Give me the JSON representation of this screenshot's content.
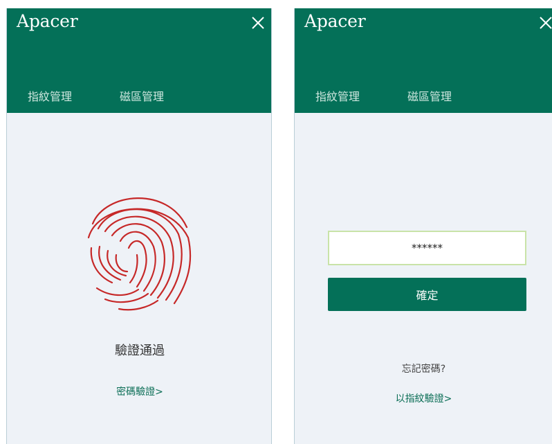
{
  "left_panel": {
    "brand": "Apacer",
    "tabs": [
      "指紋管理",
      "磁區管理"
    ],
    "status_text": "驗證通過",
    "switch_link": "密碼驗證>"
  },
  "right_panel": {
    "brand": "Apacer",
    "tabs": [
      "指紋管理",
      "磁區管理"
    ],
    "password_value": "******",
    "confirm_label": "確定",
    "forgot_link": "忘記密碼?",
    "switch_link": "以指紋驗證>"
  },
  "colors": {
    "header": "#047058",
    "accent_green": "#0b6e56",
    "fingerprint": "#c62828",
    "panel_bg": "#eef2f7",
    "input_border": "#c9e3a8"
  },
  "icons": {
    "close": "close-icon",
    "fingerprint": "fingerprint-icon"
  }
}
